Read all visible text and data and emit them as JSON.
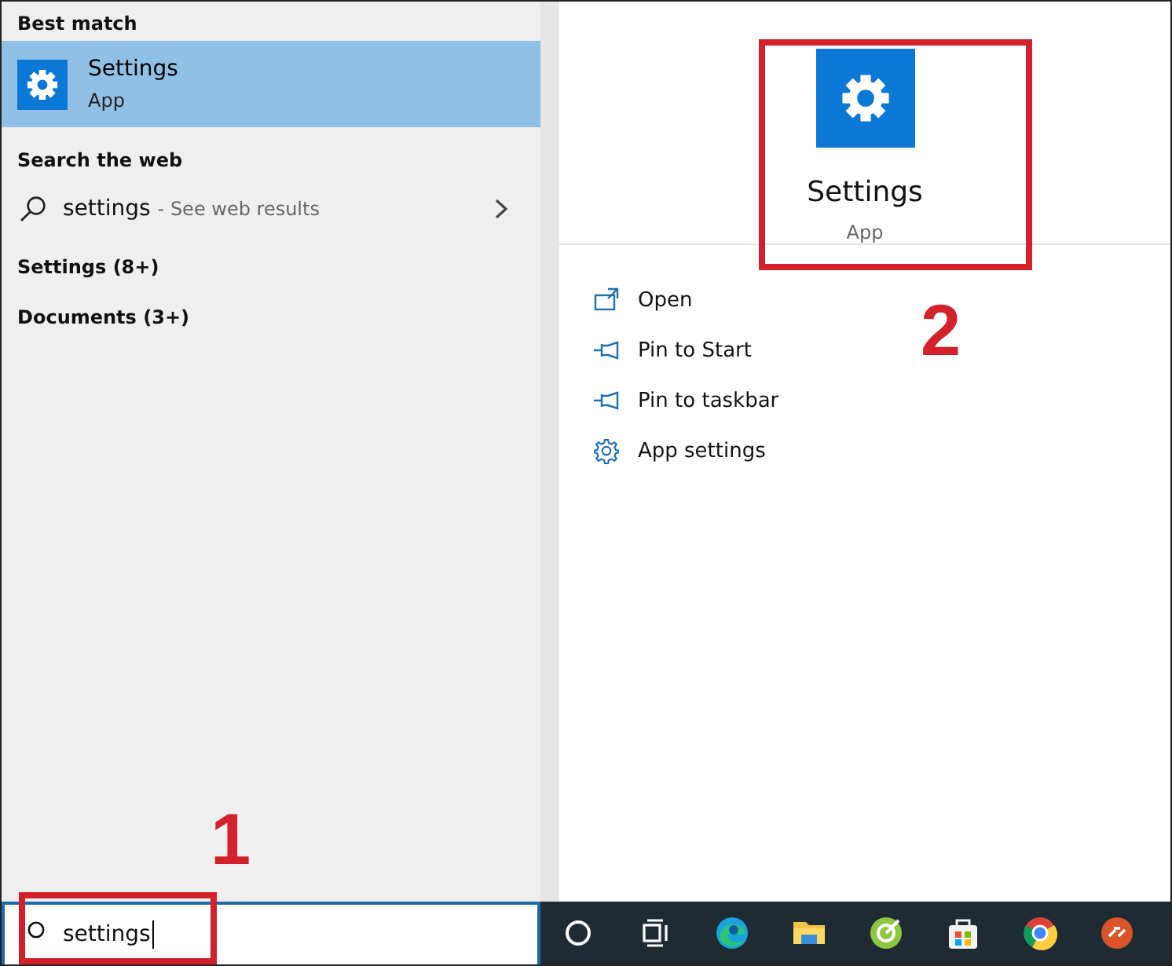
{
  "search_results": {
    "best_match": {
      "heading": "Best match",
      "title": "Settings",
      "subtitle": "App",
      "selected": true
    },
    "web": {
      "heading": "Search the web",
      "query": "settings",
      "hint": "- See web results"
    },
    "categories": [
      {
        "label": "Settings (8+)"
      },
      {
        "label": "Documents (3+)"
      }
    ]
  },
  "preview": {
    "title": "Settings",
    "subtitle": "App",
    "actions": [
      {
        "label": "Open",
        "kind": "open"
      },
      {
        "label": "Pin to Start",
        "kind": "pin"
      },
      {
        "label": "Pin to taskbar",
        "kind": "pin"
      },
      {
        "label": "App settings",
        "kind": "gear"
      }
    ]
  },
  "search_box": {
    "value": "settings"
  },
  "annotations": [
    {
      "label": "1"
    },
    {
      "label": "2"
    }
  ]
}
